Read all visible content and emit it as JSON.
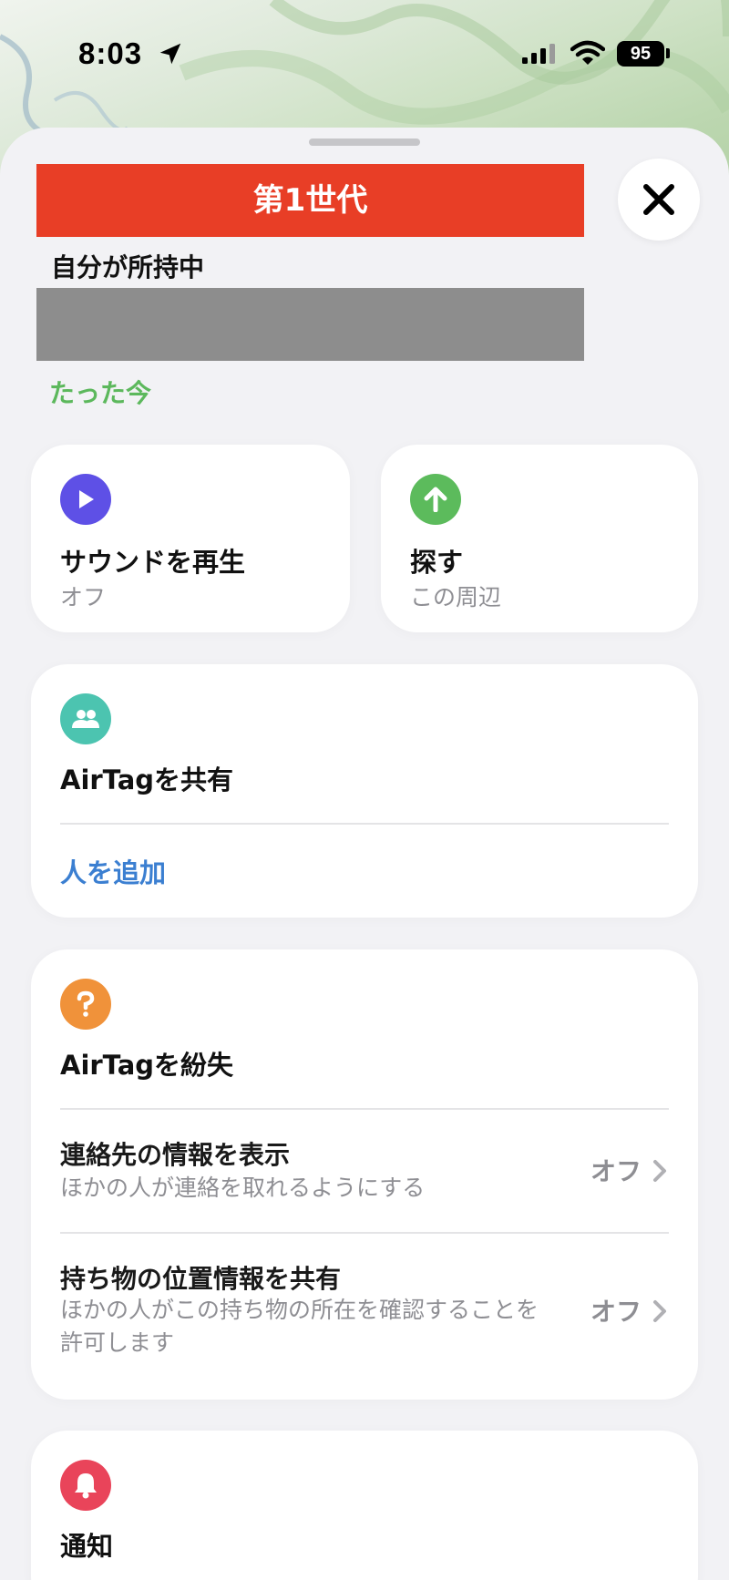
{
  "status_bar": {
    "time": "8:03",
    "battery": "95"
  },
  "header": {
    "generation_banner": "第1世代",
    "owner_status": "自分が所持中",
    "last_seen": "たった今"
  },
  "actions": {
    "play_sound": {
      "title": "サウンドを再生",
      "subtitle": "オフ"
    },
    "find": {
      "title": "探す",
      "subtitle": "この周辺"
    }
  },
  "share": {
    "title": "AirTagを共有",
    "add_person": "人を追加"
  },
  "lost": {
    "title": "AirTagを紛失",
    "rows": [
      {
        "title": "連絡先の情報を表示",
        "subtitle": "ほかの人が連絡を取れるようにする",
        "value": "オフ"
      },
      {
        "title": "持ち物の位置情報を共有",
        "subtitle_line1": "ほかの人がこの持ち物の所在を確認することを",
        "subtitle_line2": "許可します",
        "value": "オフ"
      }
    ]
  },
  "notifications": {
    "title": "通知"
  },
  "colors": {
    "banner": "#e83e26",
    "play_icon": "#5e50e6",
    "find_icon": "#5cbb5c",
    "share_icon": "#4cc4b0",
    "lost_icon": "#f0923a",
    "notify_icon": "#e9445a",
    "link": "#3b7fd1"
  }
}
